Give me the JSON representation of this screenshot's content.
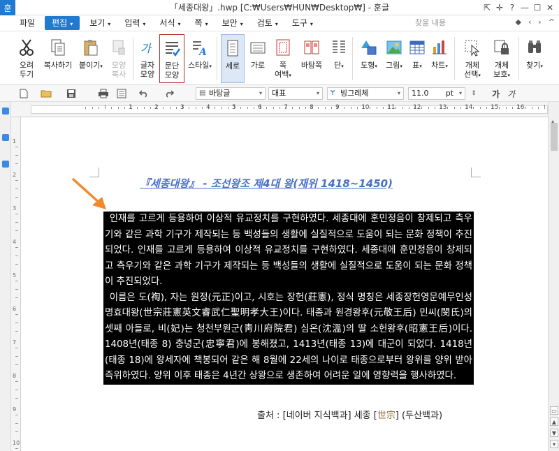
{
  "window": {
    "title": "「세종대왕」.hwp [C:₩Users₩HUN₩Desktop₩] - 훈글",
    "app_icon_label": "훈",
    "controls": [
      "⇱",
      "✛",
      "?",
      "—",
      "☐",
      "✕"
    ]
  },
  "menu": {
    "items": [
      {
        "label": "파일"
      },
      {
        "label": "편집",
        "active": true
      },
      {
        "label": "보기"
      },
      {
        "label": "입력"
      },
      {
        "label": "서식"
      },
      {
        "label": "쪽"
      },
      {
        "label": "보안"
      },
      {
        "label": "검토"
      },
      {
        "label": "도구"
      }
    ],
    "dropdown_mark": "▾",
    "search_placeholder": "찾을 내용",
    "right_icons": [
      "◆",
      "‹",
      "›",
      "^"
    ]
  },
  "ribbon": {
    "buttons": [
      {
        "name": "cut",
        "line1": "오려",
        "line2": "두기"
      },
      {
        "name": "copy",
        "line1": "복사하기",
        "line2": ""
      },
      {
        "name": "paste",
        "line1": "붙이기",
        "line2": ""
      },
      {
        "name": "format-copy",
        "line1": "모양",
        "line2": "복사"
      },
      {
        "name": "char-shape",
        "line1": "글자",
        "line2": "모양"
      },
      {
        "name": "para-shape",
        "line1": "문단",
        "line2": "모양"
      },
      {
        "name": "style",
        "line1": "스타일",
        "line2": ""
      },
      {
        "name": "portrait",
        "line1": "세로",
        "line2": ""
      },
      {
        "name": "landscape",
        "line1": "가로",
        "line2": ""
      },
      {
        "name": "margin",
        "line1": "쪽",
        "line2": "여백"
      },
      {
        "name": "background",
        "line1": "바탕쪽",
        "line2": ""
      },
      {
        "name": "column",
        "line1": "단",
        "line2": ""
      },
      {
        "name": "shape",
        "line1": "도형",
        "line2": ""
      },
      {
        "name": "picture",
        "line1": "그림",
        "line2": ""
      },
      {
        "name": "table",
        "line1": "표",
        "line2": ""
      },
      {
        "name": "chart",
        "line1": "차트",
        "line2": ""
      },
      {
        "name": "object-select",
        "line1": "개체",
        "line2": "선택"
      },
      {
        "name": "object-protect",
        "line1": "개체",
        "line2": "보호"
      },
      {
        "name": "find",
        "line1": "찾기",
        "line2": ""
      }
    ]
  },
  "toolbar": {
    "style_select": "바탕글",
    "para_select": "대표",
    "font_select": "빙그레체",
    "size_select": "11.0",
    "size_unit": "pt",
    "font_prefix": "Ɏ",
    "text_buttons": [
      "가",
      "가"
    ]
  },
  "ruler": {
    "numbers": [
      "1",
      "2",
      "3",
      "4",
      "5",
      "6",
      "7",
      "8",
      "9",
      "10",
      "11",
      "12",
      "13",
      "14",
      "15",
      "16",
      "17"
    ],
    "vnumbers": [
      "1",
      "2",
      "3",
      "4",
      "5",
      "6",
      "7",
      "8",
      "9",
      "10"
    ]
  },
  "document": {
    "title": "『세종대왕』 - 조선왕조 제4대 왕(재위 1418~1450)",
    "para1": "인재를 고르게 등용하여 이상적 유교정치를 구현하였다. 세종대에 훈민정음이 창제되고 측우기와 같은 과학 기구가 제작되는 등 백성들의 생활에 실질적으로 도움이 되는 문화 정책이 추진되었다. 인재를 고르게 등용하여 이상적 유교정치를 구현하였다. 세종대에 훈민정음이 창제되고 측우기와 같은 과학 기구가 제작되는 등 백성들의 생활에 실질적으로 도움이 되는 문화 정책이 추진되었다.",
    "para2": "이름은 도(祹), 자는 원정(元正)이고, 시호는 장헌(莊憲), 정식 명칭은 세종장헌영문예무인성명효대왕(世宗莊憲英文睿武仁聖明孝大王)이다. 태종과 원경왕후(元敬王后) 민씨(閔氏)의 셋째 아들로, 비(妃)는 청천부원군(靑川府院君) 심온(沈溫)의 딸 소헌왕후(昭憲王后)이다. 1408년(태종 8) 충녕군(忠寧君)에 봉해졌고, 1413년(태종 13)에 대군이 되었다. 1418년(태종 18)에 왕세자에 책봉되어 같은 해 8월에 22세의 나이로 태종으로부터 왕위를 양위 받아 즉위하였다. 양위 이후 태종은 4년간 상왕으로 생존하여 어려운 일에 영향력을 행사하였다.",
    "source_prefix": "출처 : [네이버 지식백과] 세종 [",
    "source_han": "世宗",
    "source_suffix": "] (두산백과)"
  },
  "colors": {
    "accent": "#1f7ad0",
    "title": "#4a6fc8",
    "arrow": "#f08a2c",
    "selection": "#000000",
    "highlight_border": "#a83232"
  }
}
